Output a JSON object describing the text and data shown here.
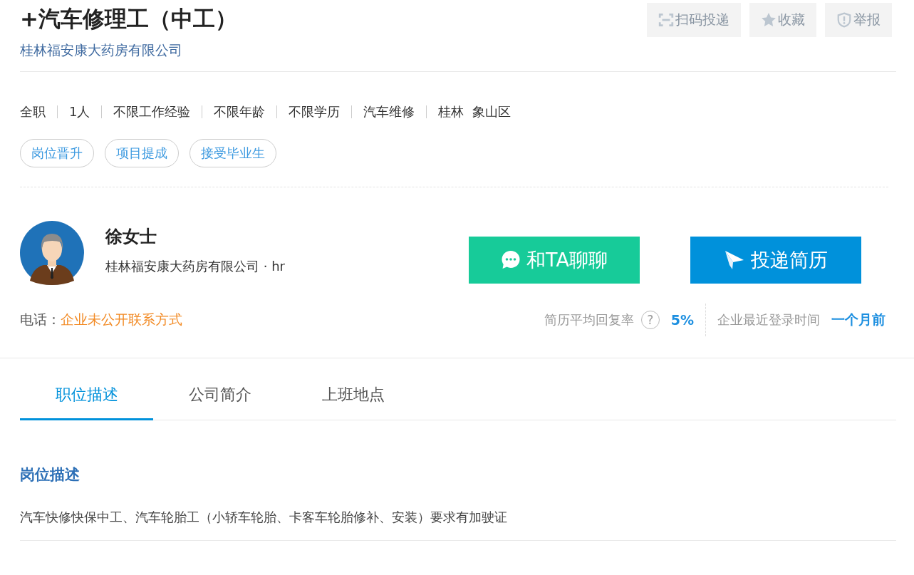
{
  "job": {
    "title": "+汽车修理工（中工）",
    "company": "桂林福安康大药房有限公司"
  },
  "actions": [
    {
      "kind": "scan",
      "label": "扫码投递"
    },
    {
      "kind": "star",
      "label": "收藏"
    },
    {
      "kind": "report",
      "label": "举报"
    }
  ],
  "meta": [
    "全职",
    "1人",
    "不限工作经验",
    "不限年龄",
    "不限学历",
    "汽车维修",
    "桂林  象山区"
  ],
  "tags": [
    "岗位晋升",
    "项目提成",
    "接受毕业生"
  ],
  "recruiter": {
    "name": "徐女士",
    "role": "桂林福安康大药房有限公司 · hr"
  },
  "buttons": [
    {
      "kind": "chat",
      "label": "和TA聊聊"
    },
    {
      "kind": "apply",
      "label": "投递简历"
    }
  ],
  "phone": {
    "label": "电话：",
    "value": "企业未公开联系方式"
  },
  "stats": [
    {
      "label": "简历平均回复率",
      "help": "?",
      "value": "5%"
    },
    {
      "label": "企业最近登录时间",
      "value": "一个月前"
    }
  ],
  "tabs": [
    {
      "label": "职位描述",
      "selected": true
    },
    {
      "label": "公司简介",
      "selected": false
    },
    {
      "label": "上班地点",
      "selected": false
    }
  ],
  "section": {
    "heading": "岗位描述",
    "text": "汽车快修快保中工、汽车轮胎工（小轿车轮胎、卡客车轮胎修补、安装）要求有加驶证"
  }
}
